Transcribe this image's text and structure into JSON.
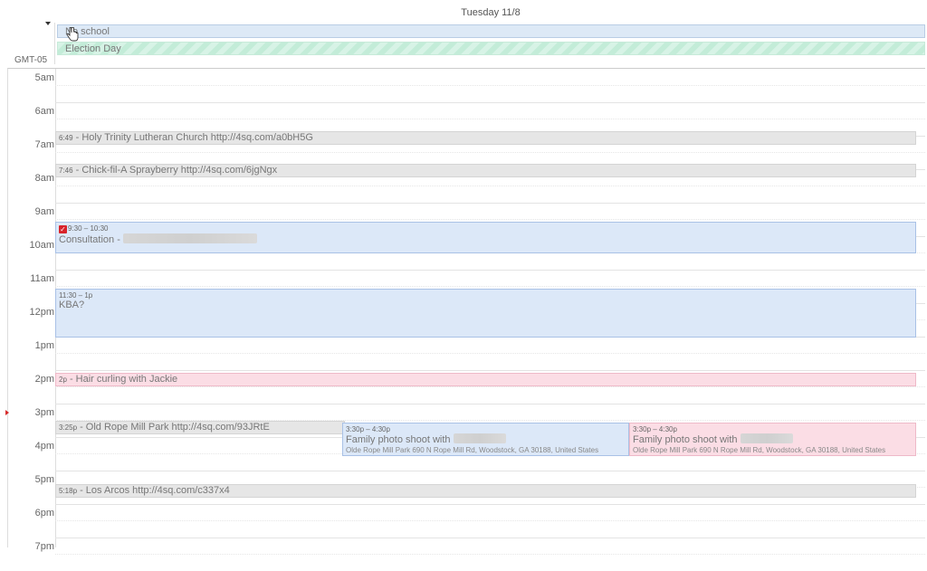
{
  "header": {
    "day_title": "Tuesday 11/8"
  },
  "timezone": "GMT-05",
  "allday": [
    {
      "title": "No school"
    },
    {
      "title": "Election Day"
    }
  ],
  "hours": [
    "5am",
    "6am",
    "7am",
    "8am",
    "9am",
    "10am",
    "11am",
    "12pm",
    "1pm",
    "2pm",
    "3pm",
    "4pm",
    "5pm",
    "6pm",
    "7pm"
  ],
  "events": {
    "holy_trinity": {
      "time": "6:49",
      "title": " - Holy Trinity Lutheran Church http://4sq.com/a0bH5G"
    },
    "chickfila": {
      "time": "7:46",
      "title": " - Chick-fil-A Sprayberry http://4sq.com/6jgNgx"
    },
    "consultation": {
      "time": "9:30 – 10:30",
      "title": "Consultation - "
    },
    "kba": {
      "time": "11:30 – 1p",
      "title": "KBA?"
    },
    "hair": {
      "time": "2p",
      "title": " - Hair curling with Jackie"
    },
    "old_rope": {
      "time": "3:25p",
      "title": " - Old Rope Mill Park http://4sq.com/93JRtE"
    },
    "photo1": {
      "time": "3:30p – 4:30p",
      "title": "Family photo shoot with ",
      "where": "Olde Rope Mill Park 690 N Rope Mill Rd, Woodstock, GA 30188, United States"
    },
    "photo2": {
      "time": "3:30p – 4:30p",
      "title": "Family photo shoot with ",
      "where": "Olde Rope Mill Park 690 N Rope Mill Rd, Woodstock, GA 30188, United States"
    },
    "los_arcos": {
      "time": "5:18p",
      "title": " - Los Arcos http://4sq.com/c337x4"
    }
  },
  "icons": {
    "reminder": "reminder-icon",
    "cursor": "hand-cursor-icon",
    "collapse": "collapse-arrow-icon"
  },
  "colors": {
    "blue_event": "#dce8f8",
    "pink_event": "#fbdde5",
    "checkin": "#e6e6e6",
    "now": "#d62b2b"
  }
}
